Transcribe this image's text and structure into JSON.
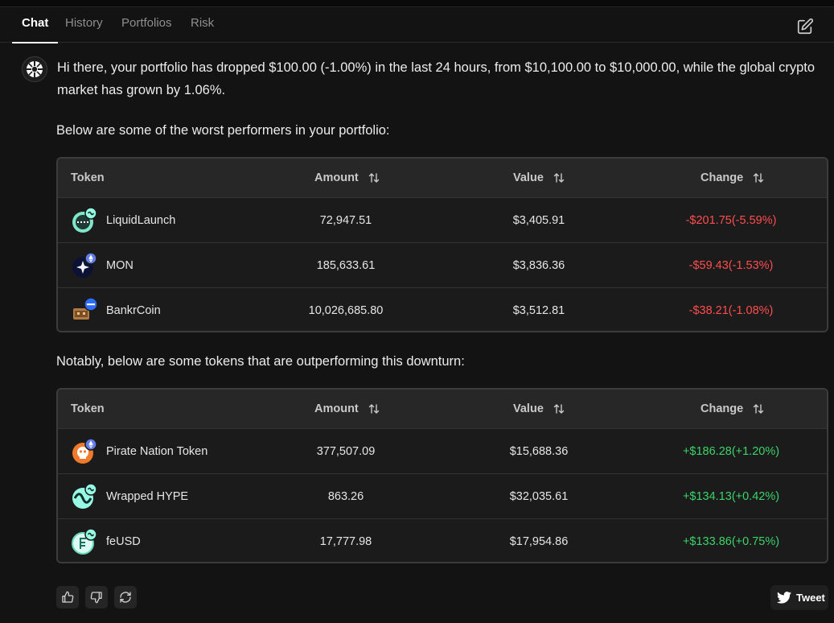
{
  "tabs": [
    {
      "label": "Chat",
      "active": true
    },
    {
      "label": "History",
      "active": false
    },
    {
      "label": "Portfolios",
      "active": false
    },
    {
      "label": "Risk",
      "active": false
    }
  ],
  "message": {
    "intro": "Hi there, your portfolio has dropped $100.00 (-1.00%) in the last 24 hours, from $10,100.00 to $10,000.00, while the global crypto market has grown by 1.06%.",
    "worst_heading": "Below are some of the worst performers in your portfolio:",
    "best_heading": "Notably, below are some tokens that are outperforming this downturn:"
  },
  "table_headers": {
    "token": "Token",
    "amount": "Amount",
    "value": "Value",
    "change": "Change"
  },
  "worst": [
    {
      "token": "LiquidLaunch",
      "icon": "liquidlaunch-token-icon",
      "amount": "72,947.51",
      "value": "$3,405.91",
      "change": "-$201.75(-5.59%)"
    },
    {
      "token": "MON",
      "icon": "mon-token-icon",
      "amount": "185,633.61",
      "value": "$3,836.36",
      "change": "-$59.43(-1.53%)"
    },
    {
      "token": "BankrCoin",
      "icon": "bankrcoin-token-icon",
      "amount": "10,026,685.80",
      "value": "$3,512.81",
      "change": "-$38.21(-1.08%)"
    }
  ],
  "best": [
    {
      "token": "Pirate Nation Token",
      "icon": "pirate-nation-token-icon",
      "amount": "377,507.09",
      "value": "$15,688.36",
      "change": "+$186.28(+1.20%)"
    },
    {
      "token": "Wrapped HYPE",
      "icon": "wrapped-hype-token-icon",
      "amount": "863.26",
      "value": "$32,035.61",
      "change": "+$134.13(+0.42%)"
    },
    {
      "token": "feUSD",
      "icon": "feusd-token-icon",
      "amount": "17,777.98",
      "value": "$17,954.86",
      "change": "+$133.86(+0.75%)"
    }
  ],
  "actions": {
    "tweet_label": "Tweet"
  },
  "colors": {
    "negative": "#ff4d4d",
    "positive": "#3bd36a",
    "background": "#131313",
    "hype_green": "#97fce4",
    "eth_badge": "#627eea"
  }
}
